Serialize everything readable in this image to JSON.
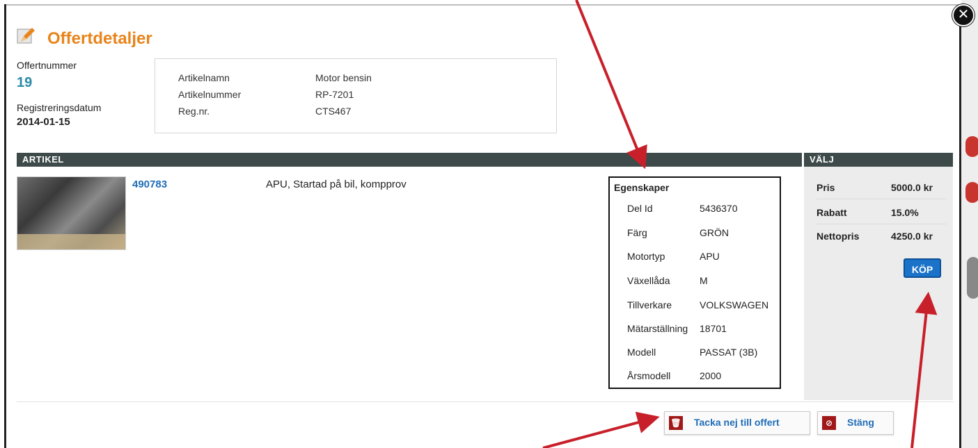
{
  "header": {
    "title": "Offertdetaljer",
    "offer_number_label": "Offertnummer",
    "offer_number": "19",
    "registration_date_label": "Registreringsdatum",
    "registration_date": "2014-01-15"
  },
  "info": {
    "rows": [
      {
        "label": "Artikelnamn",
        "value": "Motor bensin"
      },
      {
        "label": "Artikelnummer",
        "value": "RP-7201"
      },
      {
        "label": "Reg.nr.",
        "value": "CTS467"
      }
    ]
  },
  "table": {
    "article_header": "ARTIKEL",
    "select_header": "VÄLJ"
  },
  "article": {
    "id": "490783",
    "description": "APU, Startad på bil, kompprov"
  },
  "properties": {
    "title": "Egenskaper",
    "items": [
      {
        "label": "Del Id",
        "value": "5436370"
      },
      {
        "label": "Färg",
        "value": "GRÖN"
      },
      {
        "label": "Motortyp",
        "value": "APU"
      },
      {
        "label": "Växellåda",
        "value": "M"
      },
      {
        "label": "Tillverkare",
        "value": "VOLKSWAGEN"
      },
      {
        "label": "Mätarställning",
        "value": "18701"
      },
      {
        "label": "Modell",
        "value": "PASSAT (3B)"
      },
      {
        "label": "Årsmodell",
        "value": "2000"
      }
    ]
  },
  "pricing": {
    "rows": [
      {
        "label": "Pris",
        "value": "5000.0 kr"
      },
      {
        "label": "Rabatt",
        "value": "15.0%"
      },
      {
        "label": "Nettopris",
        "value": "4250.0 kr"
      }
    ],
    "buy_label": "KÖP"
  },
  "footer": {
    "decline_label": "Tacka nej till offert",
    "close_label": "Stäng"
  },
  "colors": {
    "accent_orange": "#e8841b",
    "link_blue": "#1f6db8",
    "header_bar": "#3e4a4a",
    "buy_button": "#1b73c9",
    "annotation_arrow": "#c8202a"
  },
  "icons": [
    "close-icon",
    "pencil-icon",
    "trash-icon",
    "no-entry-icon"
  ]
}
